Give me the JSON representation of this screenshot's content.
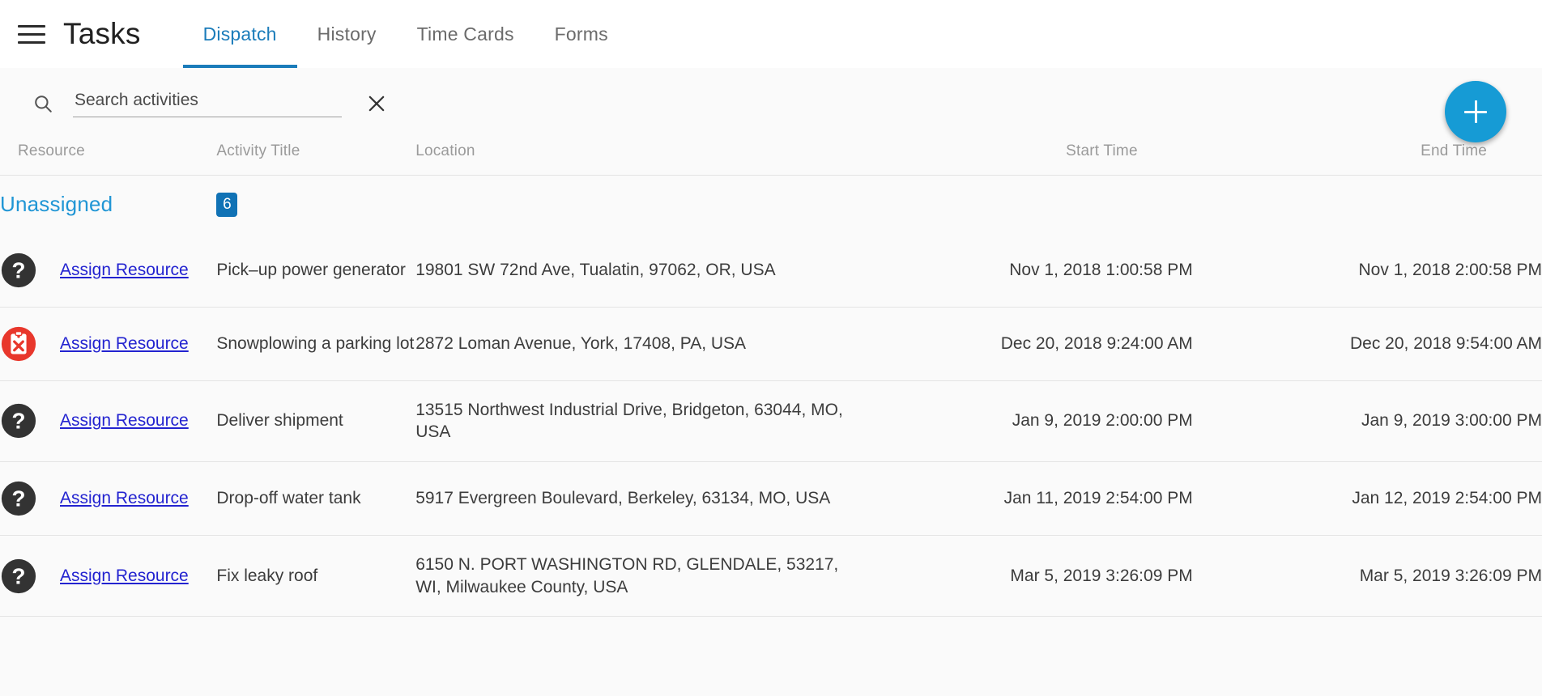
{
  "appbar": {
    "menu_icon": "hamburger-menu-icon",
    "title": "Tasks",
    "tabs": [
      {
        "label": "Dispatch",
        "active": true
      },
      {
        "label": "History",
        "active": false
      },
      {
        "label": "Time Cards",
        "active": false
      },
      {
        "label": "Forms",
        "active": false
      }
    ]
  },
  "search": {
    "icon": "search-icon",
    "placeholder": "Search activities",
    "value": "",
    "clear_icon": "close-icon"
  },
  "fab": {
    "icon": "plus-icon",
    "label": "+",
    "color": "#169bd5"
  },
  "table": {
    "columns": [
      {
        "key": "resource",
        "label": "Resource"
      },
      {
        "key": "title",
        "label": "Activity Title"
      },
      {
        "key": "location",
        "label": "Location"
      },
      {
        "key": "start",
        "label": "Start Time"
      },
      {
        "key": "end",
        "label": "End Time"
      }
    ],
    "group": {
      "name": "Unassigned",
      "count": "6",
      "name_color": "#2196d5",
      "badge_color": "#1072b5"
    },
    "rows": [
      {
        "status_icon": "question-mark-icon",
        "assign_label": "Assign Resource",
        "title": "Pick–up power generator",
        "location": "19801 SW 72nd Ave, Tualatin, 97062, OR, USA",
        "start": "Nov 1, 2018 1:00:58 PM",
        "end": "Nov 1, 2018 2:00:58 PM"
      },
      {
        "status_icon": "clipboard-error-icon",
        "assign_label": "Assign Resource",
        "title": "Snowplowing a parking lot",
        "location": "2872 Loman Avenue, York, 17408, PA, USA",
        "start": "Dec 20, 2018 9:24:00 AM",
        "end": "Dec 20, 2018 9:54:00 AM"
      },
      {
        "status_icon": "question-mark-icon",
        "assign_label": "Assign Resource",
        "title": "Deliver shipment",
        "location": "13515 Northwest Industrial Drive, Bridgeton, 63044, MO, USA",
        "start": "Jan 9, 2019 2:00:00 PM",
        "end": "Jan 9, 2019 3:00:00 PM"
      },
      {
        "status_icon": "question-mark-icon",
        "assign_label": "Assign Resource",
        "title": "Drop-off water tank",
        "location": "5917 Evergreen Boulevard, Berkeley, 63134, MO, USA",
        "start": "Jan 11, 2019 2:54:00 PM",
        "end": "Jan 12, 2019 2:54:00 PM"
      },
      {
        "status_icon": "question-mark-icon",
        "assign_label": "Assign Resource",
        "title": "Fix leaky roof",
        "location": "6150 N. PORT WASHINGTON RD, GLENDALE, 53217, WI, Milwaukee County, USA",
        "start": "Mar 5, 2019 3:26:09 PM",
        "end": "Mar 5, 2019 3:26:09 PM"
      }
    ]
  }
}
